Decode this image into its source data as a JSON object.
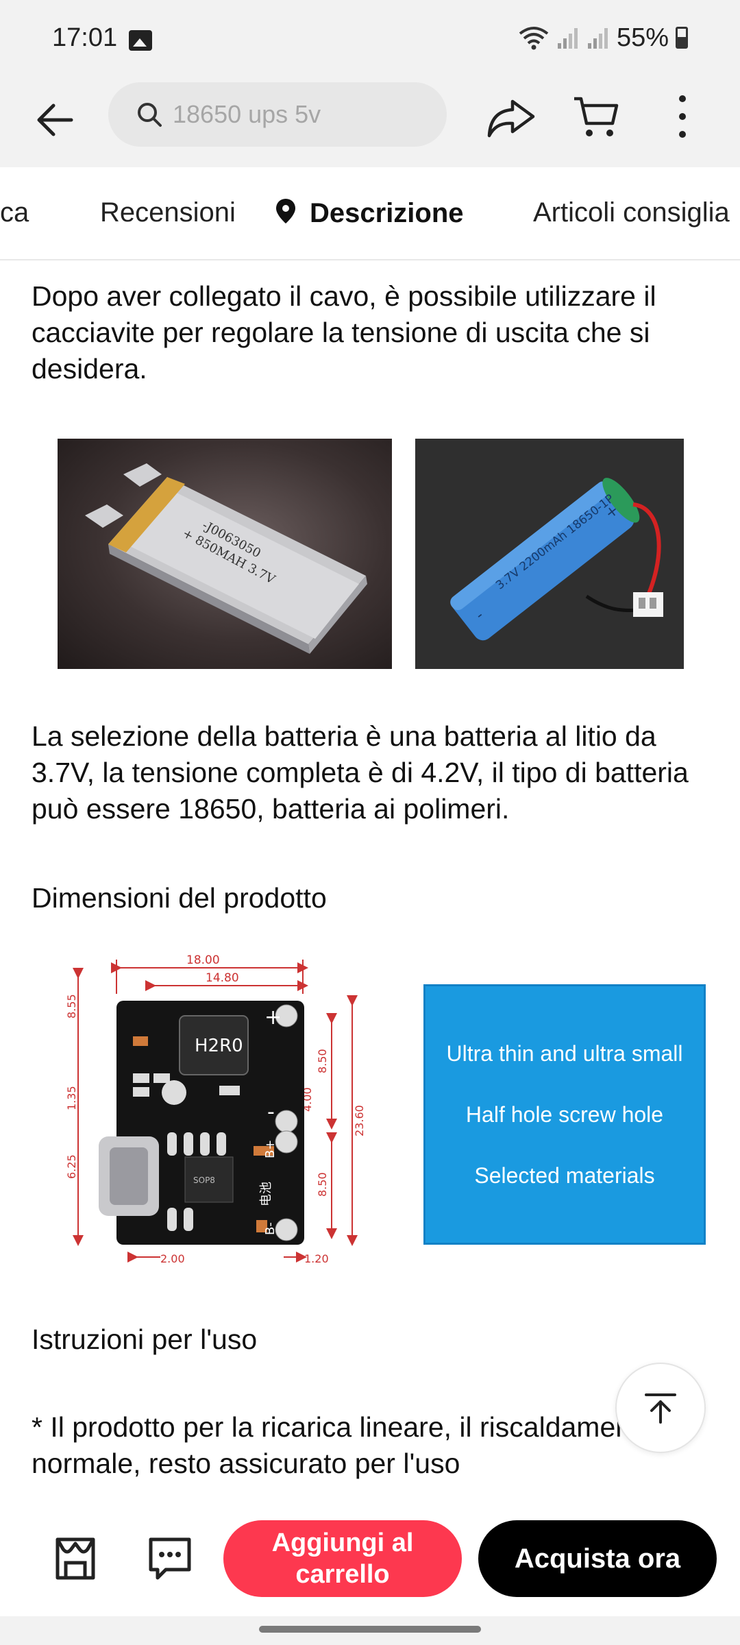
{
  "status_bar": {
    "time": "17:01",
    "battery": "55%"
  },
  "header": {
    "search_placeholder": "18650 ups 5v",
    "icons": [
      "back-arrow-icon",
      "search-icon",
      "share-icon",
      "cart-icon",
      "more-vertical-icon"
    ]
  },
  "tabs": [
    {
      "label": "ca"
    },
    {
      "label": "Recensioni"
    },
    {
      "label": "Descrizione",
      "active": true
    },
    {
      "label": "Articoli consiglia"
    }
  ],
  "description": {
    "paragraph_1": "Dopo aver collegato il cavo, è possibile utilizzare il cacciavite per regolare la tensione di uscita che si desidera.",
    "pouch_battery_label": "-J0063050\n+ 850MAH 3.7V",
    "cell_battery_label": "3.7V 2200mAh  18650-1P",
    "paragraph_2": "La selezione della batteria è una batteria al litio da 3.7V, la tensione completa è di 4.2V, il tipo di batteria può essere 18650, batteria ai polimeri.",
    "dimensions_heading": "Dimensioni del prodotto",
    "board": {
      "chip_label": "H2R0",
      "ic_label": "SOP8",
      "width_total": "18.00",
      "width_inner": "14.80",
      "height_total": "23.60",
      "dim_top_left": "8.55",
      "dim_mid_left": "1.35",
      "dim_low_left": "6.25",
      "dim_right_a": "4.00",
      "dim_right_b": "8.50",
      "dim_right_c": "8.50",
      "dim_bottom_left": "2.00",
      "dim_bottom_right": "1.20",
      "pad_plus": "+",
      "pad_minus": "-",
      "pad_bplus": "B+",
      "pad_bminus": "B-",
      "pad_cn": "电池"
    },
    "features": [
      "Ultra thin and ultra small",
      "Half hole screw hole",
      "Selected materials"
    ],
    "instructions_heading": "Istruzioni per l'uso",
    "paragraph_3": "* Il prodotto per la ricarica lineare, il riscaldamento è normale, resto assicurato per l'uso"
  },
  "bottom_bar": {
    "add_to_cart": "Aggiungi al carrello",
    "buy_now": "Acquista ora"
  },
  "colors": {
    "accent_red": "#fd384f",
    "buy_black": "#000000",
    "feature_blue": "#1a9ae0"
  }
}
